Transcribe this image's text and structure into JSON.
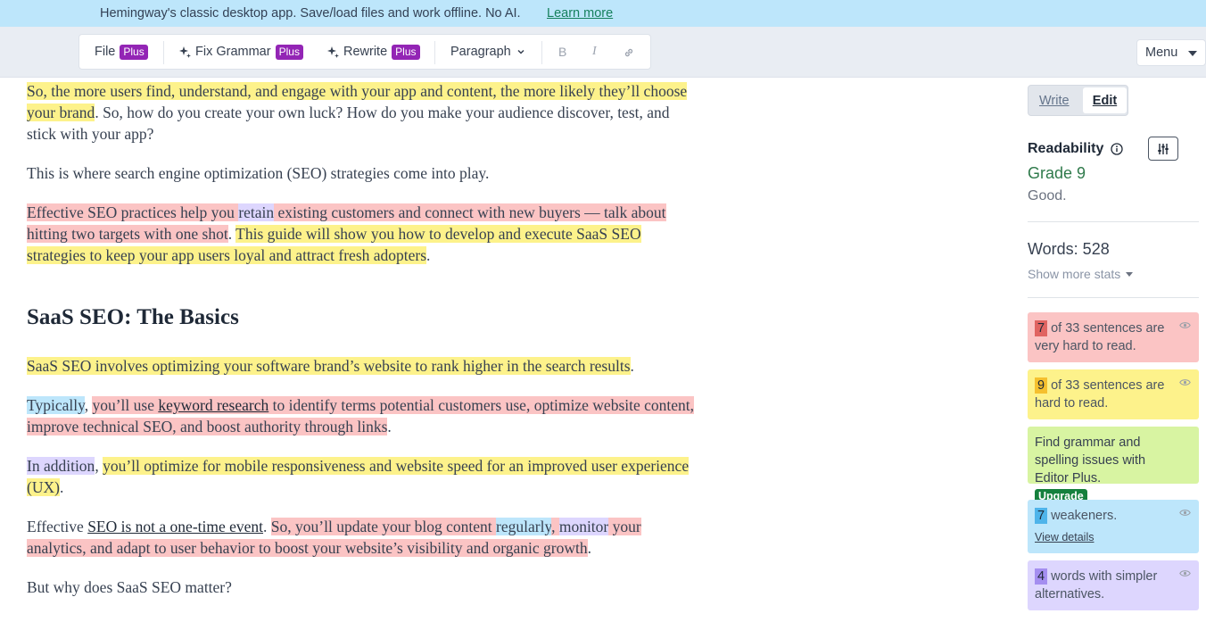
{
  "banner": {
    "text": "Hemingway's classic desktop app. Save/load files and work offline. No AI.",
    "link": "Learn more"
  },
  "toolbar": {
    "file": "File",
    "fix_grammar": "Fix Grammar",
    "rewrite": "Rewrite",
    "plus_badge": "Plus",
    "paragraph": "Paragraph",
    "bold": "B",
    "italic": "I",
    "menu": "Menu"
  },
  "editor": {
    "p1": {
      "a": "So, the more users find, understand, and engage with your app and content, the more likely they’ll choose your brand",
      "b": ". So, how do you create your own luck? How do you make your audience discover, test, and stick with your app?"
    },
    "p2": "This is where search engine optimization (SEO) strategies come into play.",
    "p3": {
      "a": "Effective SEO practices help you ",
      "b": "retain",
      "c": " existing customers and connect with new buyers — talk about hitting two targets with one shot",
      "d": ". ",
      "e": "This guide will show you how to develop and execute SaaS SEO strategies to keep your app users loyal and attract fresh adopters",
      "f": "."
    },
    "heading": "SaaS SEO: The Basics",
    "p4": {
      "a": "SaaS SEO involves optimizing your software brand’s website to rank higher in the search results",
      "b": "."
    },
    "p5": {
      "a": "Typically",
      "b": ", ",
      "c": "you’ll use ",
      "d": "keyword research",
      "e": " to identify terms potential customers use, optimize website content, improve technical SEO, and boost authority through links",
      "f": "."
    },
    "p6": {
      "a": "In addition",
      "b": ", ",
      "c": "you’ll optimize for mobile responsiveness and website speed for an improved user experience (UX)",
      "d": "."
    },
    "p7": {
      "a": "Effective ",
      "b": "SEO is not a one-time event",
      "c": ". ",
      "d": "So, you’ll update your blog content ",
      "e": "regularly",
      "f": ", ",
      "g": "monitor",
      "h": " your analytics, and adapt to user behavior to boost your website’s visibility and organic growth",
      "i": "."
    },
    "p8": "But why does SaaS SEO matter?"
  },
  "sidebar": {
    "write": "Write",
    "edit": "Edit",
    "readability_title": "Readability",
    "grade": "Grade 9",
    "verdict": "Good.",
    "words": "Words: 528",
    "more_stats": "Show more stats",
    "cards": {
      "very_hard": {
        "count": "7",
        "text": "of 33 sentences are very hard to read."
      },
      "hard": {
        "count": "9",
        "text": "of 33 sentences are hard to read."
      },
      "grammar": {
        "text": "Find grammar and spelling issues with Editor Plus.",
        "upgrade": "Upgrade"
      },
      "weakeners": {
        "count": "7",
        "text": "weakeners.",
        "link": "View details"
      },
      "simpler": {
        "count": "4",
        "text": "words with simpler alternatives."
      }
    }
  },
  "colors": {
    "yellow_highlight": "#fdf28b",
    "red_highlight": "#fbc4c4",
    "blue_highlight": "#bde6fb",
    "purple_highlight": "#ddd6fe",
    "plus_badge": "#9325b5",
    "grade_green": "#2f7a4b"
  },
  "icons": [
    "sparkle-icon",
    "chevron-down-icon",
    "link-icon",
    "info-icon",
    "sliders-icon",
    "eye-icon",
    "caret-down-icon"
  ]
}
